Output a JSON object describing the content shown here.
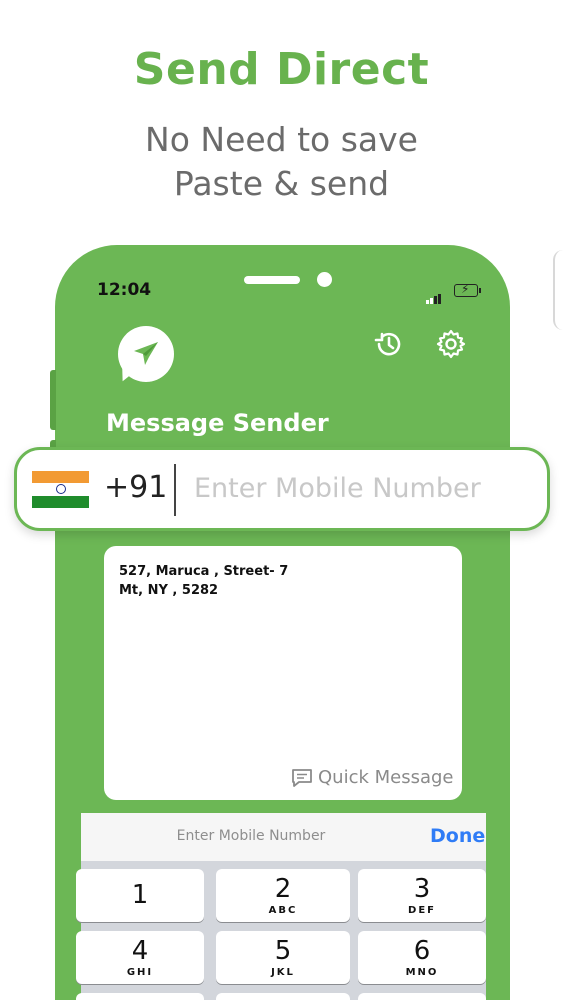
{
  "header": {
    "title": "Send Direct",
    "subtitle_line1": "No Need to save",
    "subtitle_line2": "Paste & send"
  },
  "status_bar": {
    "time": "12:04",
    "icons": [
      "signal-icon",
      "battery-charging-icon"
    ]
  },
  "app": {
    "title": "Message Sender",
    "logo_icon": "paper-plane-icon",
    "actions": [
      "history-icon",
      "gear-icon"
    ]
  },
  "number_input": {
    "country_flag": "india-flag-icon",
    "country_code": "+91",
    "placeholder": "Enter Mobile Number",
    "value": ""
  },
  "message": {
    "line1": "527, Maruca , Street- 7",
    "line2": "Mt, NY , 5282",
    "quick_label": "Quick Message",
    "quick_icon": "chat-bubble-icon"
  },
  "keyboard": {
    "hint": "Enter Mobile Number",
    "done_label": "Done",
    "keys": [
      {
        "num": "1",
        "letters": ""
      },
      {
        "num": "2",
        "letters": "ABC"
      },
      {
        "num": "3",
        "letters": "DEF"
      },
      {
        "num": "4",
        "letters": "GHI"
      },
      {
        "num": "5",
        "letters": "JKL"
      },
      {
        "num": "6",
        "letters": "MNO"
      }
    ]
  },
  "colors": {
    "brand_green": "#6cb755",
    "headline_green": "#68b24e",
    "done_blue": "#2f7cf6"
  }
}
